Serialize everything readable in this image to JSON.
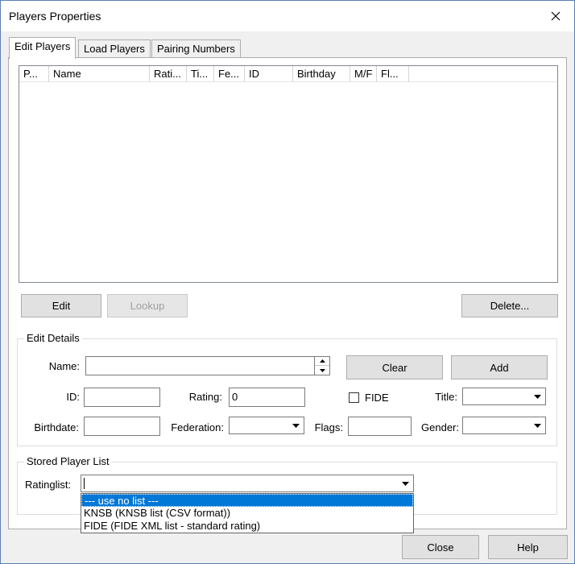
{
  "window": {
    "title": "Players Properties"
  },
  "tabs": [
    {
      "label": "Edit Players",
      "active": true
    },
    {
      "label": "Load Players",
      "active": false
    },
    {
      "label": "Pairing Numbers",
      "active": false
    }
  ],
  "list": {
    "columns": [
      "P...",
      "Name",
      "Rati...",
      "Ti...",
      "Fe...",
      "ID",
      "Birthday",
      "M/F",
      "Fl..."
    ]
  },
  "list_buttons": {
    "edit": "Edit",
    "lookup": "Lookup",
    "delete": "Delete..."
  },
  "edit_details": {
    "title": "Edit Details",
    "name_label": "Name:",
    "name_value": "",
    "clear": "Clear",
    "add": "Add",
    "id_label": "ID:",
    "rating_label": "Rating:",
    "rating_value": "0",
    "fide_label": "FIDE",
    "title_label": "Title:",
    "birthdate_label": "Birthdate:",
    "federation_label": "Federation:",
    "flags_label": "Flags:",
    "gender_label": "Gender:"
  },
  "stored": {
    "title": "Stored Player List",
    "ratinglist_label": "Ratinglist:",
    "options": [
      "--- use no list ---",
      "KNSB (KNSB list (CSV format))",
      "FIDE (FIDE XML list - standard rating)"
    ]
  },
  "footer": {
    "close": "Close",
    "help": "Help"
  },
  "colors": {
    "selection": "#0078d7",
    "window_border": "#5a7fb5"
  }
}
